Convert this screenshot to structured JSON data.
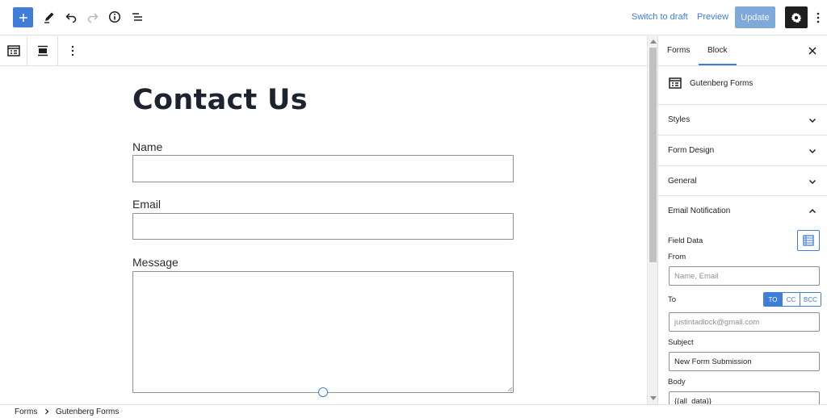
{
  "topbar": {
    "switch_to_draft": "Switch to draft",
    "preview": "Preview",
    "update": "Update",
    "icons": [
      "plus-icon",
      "pencil-icon",
      "undo-icon",
      "redo-icon",
      "info-icon",
      "list-view-icon",
      "gear-icon",
      "more-vertical-icon"
    ]
  },
  "blockbar": {
    "icons": [
      "form-block-icon",
      "align-icon",
      "more-vertical-icon"
    ]
  },
  "editor": {
    "title": "Contact Us",
    "fields": [
      {
        "label": "Name"
      },
      {
        "label": "Email"
      },
      {
        "label": "Message"
      }
    ]
  },
  "sidebar": {
    "tabs": [
      "Forms",
      "Block"
    ],
    "active_tab": "Block",
    "block_name": "Gutenberg Forms",
    "panels": [
      "Styles",
      "Form Design",
      "General",
      "Email Notification"
    ],
    "email": {
      "field_data_label": "Field Data",
      "from_label": "From",
      "from_placeholder": "Name, Email",
      "to_label": "To",
      "to_options": [
        "TO",
        "CC",
        "BCC"
      ],
      "to_selected": "TO",
      "to_value": "justintadlock@gmail.com",
      "subject_label": "Subject",
      "subject_value": "New Form Submission",
      "body_label": "Body",
      "body_value": "{{all_data}}"
    }
  },
  "breadcrumb": [
    "Forms",
    "Gutenberg Forms"
  ],
  "colors": {
    "accent": "#3f7dd6",
    "update_disabled": "#7fa8db",
    "dark": "#1e1e1e"
  }
}
